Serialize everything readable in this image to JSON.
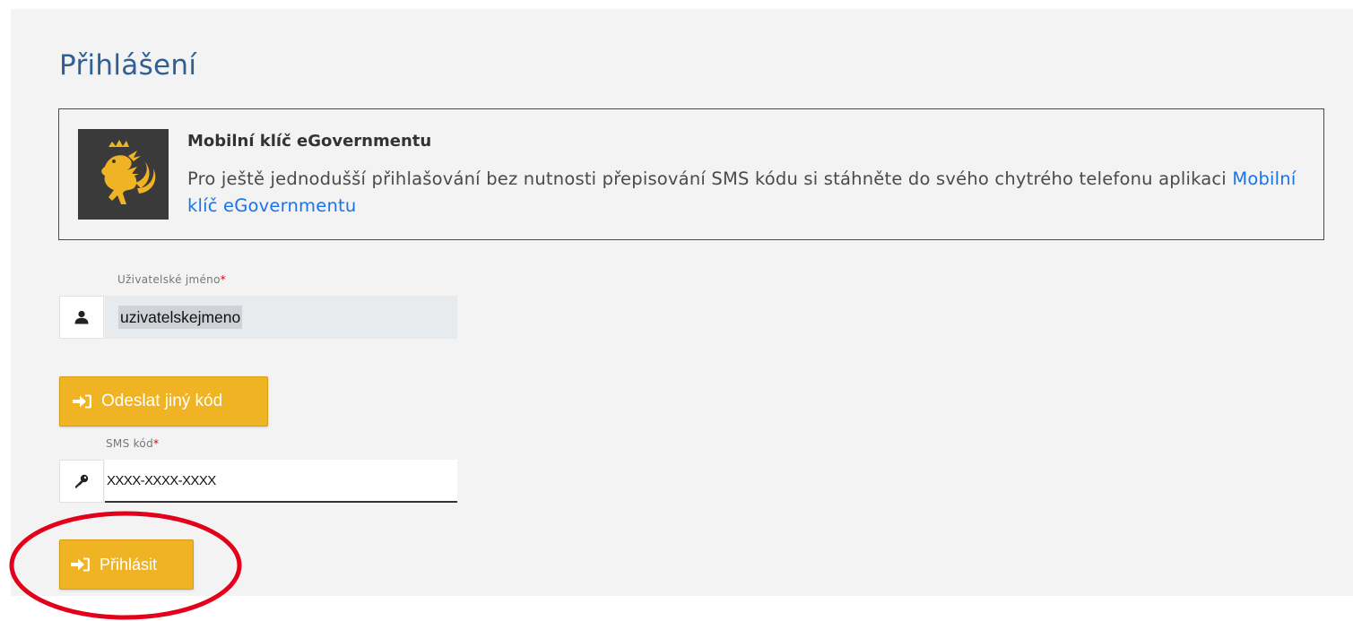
{
  "page": {
    "title": "Přihlášení"
  },
  "info": {
    "logo_icon": "czech-lion-coat-of-arms-icon",
    "title": "Mobilní klíč eGovernmentu",
    "text": "Pro ještě jednodušší přihlašování bez nutnosti přepisování SMS kódu si stáhněte do svého chytrého telefonu aplikaci ",
    "link_text": "Mobilní klíč eGovernmentu"
  },
  "username": {
    "label": "Uživatelské jméno",
    "required_mark": "*",
    "icon": "user-icon",
    "value": "uzivatelskejmeno"
  },
  "resend_button": {
    "icon": "sign-in-icon",
    "label": "Odeslat jiný kód"
  },
  "sms": {
    "label": "SMS kód",
    "required_mark": "*",
    "icon": "key-icon",
    "value": "XXXX-XXXX-XXXX"
  },
  "login_button": {
    "icon": "sign-in-icon",
    "label": "Přihlásit"
  },
  "colors": {
    "title": "#2f5f93",
    "button": "#f0b323",
    "link": "#1a73e8",
    "highlight": "#e3001b"
  }
}
